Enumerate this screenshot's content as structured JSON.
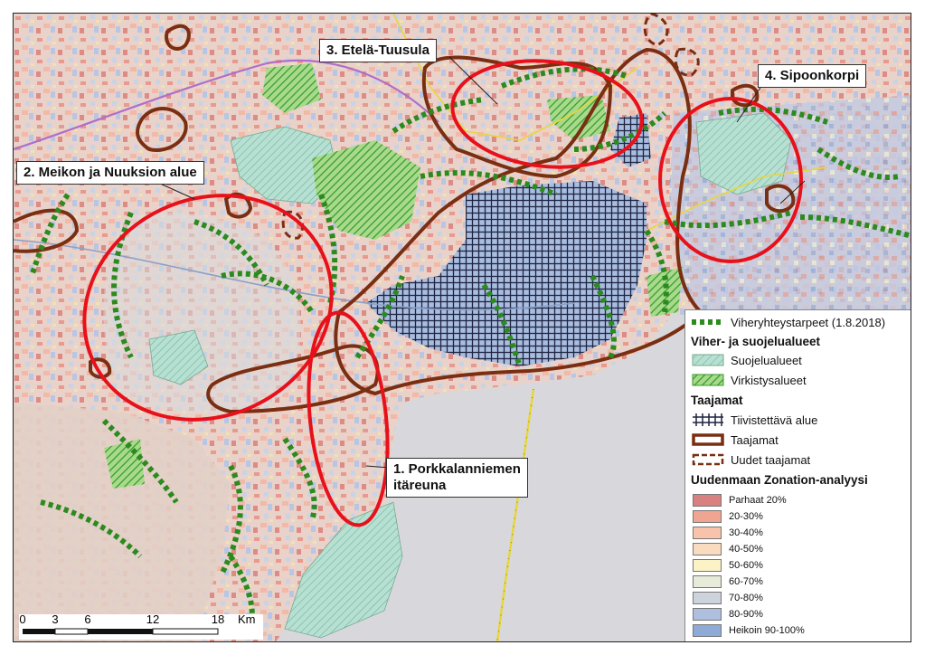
{
  "labels": {
    "area1": [
      "1. Porkkalanniemen",
      "itäreuna"
    ],
    "area2": "2. Meikon ja Nuuksion alue",
    "area3": "3. Etelä-Tuusula",
    "area4": "4. Sipoonkorpi"
  },
  "legend": {
    "green_links": "Viheryhteystarpeet (1.8.2018)",
    "green_head": "Viher- ja suojelualueet",
    "protected": "Suojelualueet",
    "recreation": "Virkistysalueet",
    "urban_head": "Taajamat",
    "densify": "Tiivistettävä alue",
    "urban": "Taajamat",
    "new_urban": "Uudet taajamat",
    "zonation_head": "Uudenmaan Zonation-analyysi",
    "zonation": [
      {
        "label": "Parhaat 20%",
        "color": "#d98080"
      },
      {
        "label": "20-30%",
        "color": "#efa592"
      },
      {
        "label": "30-40%",
        "color": "#f7c3aa"
      },
      {
        "label": "40-50%",
        "color": "#f9dcbf"
      },
      {
        "label": "50-60%",
        "color": "#fbf3c6"
      },
      {
        "label": "60-70%",
        "color": "#e6ecd9"
      },
      {
        "label": "70-80%",
        "color": "#cdd3dc"
      },
      {
        "label": "80-90%",
        "color": "#aebfe0"
      },
      {
        "label": "Heikoin 90-100%",
        "color": "#8eaad6"
      }
    ]
  },
  "scale": {
    "ticks": [
      "0",
      "3",
      "6",
      "12",
      "18"
    ],
    "unit": "Km"
  },
  "colors": {
    "sea": "#d7d7da",
    "urban_outline": "#7a2e12",
    "focus_ring": "#e8101a",
    "green_link": "#2c8a1e"
  }
}
